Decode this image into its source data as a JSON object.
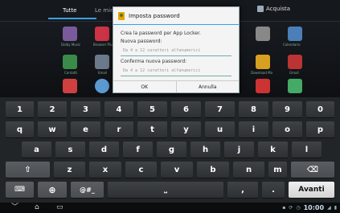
{
  "background": {
    "tabs": [
      "Tutte",
      "Le mie"
    ],
    "store_label": "Acquista",
    "row1_labels": [
      "Dolby Music",
      "Browser Plus",
      "",
      "",
      "",
      "Calendario"
    ],
    "row2_labels": [
      "Contatti",
      "Email",
      "",
      "",
      "Download Ma",
      "Gmail"
    ]
  },
  "dialog": {
    "title": "Imposta password",
    "instruction": "Crea la password per App Locker.",
    "new_label": "Nuova password:",
    "new_placeholder": "Da 4 a 12 caratteri alfanumerici",
    "confirm_label": "Conferma nuova password:",
    "confirm_placeholder": "Da 4 a 12 caratteri alfanumerici",
    "ok": "OK",
    "cancel": "Annulla"
  },
  "keyboard": {
    "row_numbers": [
      "1",
      "2",
      "3",
      "4",
      "5",
      "6",
      "7",
      "8",
      "9",
      "0"
    ],
    "row_top": [
      "q",
      "w",
      "e",
      "r",
      "t",
      "y",
      "u",
      "i",
      "o",
      "p"
    ],
    "row_home": [
      "a",
      "s",
      "d",
      "f",
      "g",
      "h",
      "j",
      "k",
      "l"
    ],
    "row_bottom": [
      "z",
      "x",
      "c",
      "v",
      "b",
      "n",
      "m"
    ],
    "shift": "⇧",
    "backspace": "⌫",
    "keyboard_switch": "⌨",
    "globe": "⊕",
    "symbols": "@#_",
    "space": "⎵",
    "comma": ",",
    "period": ".",
    "enter": "Avanti"
  },
  "navbar": {
    "back": "﹀",
    "home": "⌂",
    "recent": "▭",
    "clock": "10:00"
  }
}
